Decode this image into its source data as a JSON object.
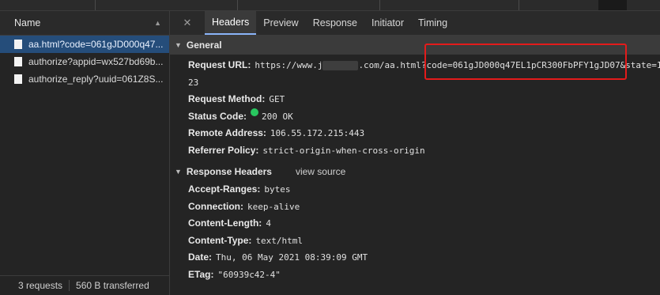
{
  "list": {
    "header": "Name",
    "requests": [
      "aa.html?code=061gJD000q47...",
      "authorize?appid=wx527bd69b...",
      "authorize_reply?uuid=061Z8S..."
    ],
    "footer": {
      "requests": "3 requests",
      "transferred": "560 B transferred"
    }
  },
  "tabs": [
    "Headers",
    "Preview",
    "Response",
    "Initiator",
    "Timing"
  ],
  "general": {
    "title": "General",
    "request_url_label": "Request URL:",
    "request_url_prefix": "https://www.j",
    "request_url_suffix": ".com/aa.html?code=061gJD000q47EL1pCR300FbPFY1gJD07&state=1",
    "request_url_wrap": "23",
    "method_label": "Request Method:",
    "method": "GET",
    "status_label": "Status Code:",
    "status": "200 OK",
    "remote_label": "Remote Address:",
    "remote": "106.55.172.215:443",
    "referrer_label": "Referrer Policy:",
    "referrer": "strict-origin-when-cross-origin"
  },
  "response": {
    "title": "Response Headers",
    "view_source": "view source",
    "headers": [
      {
        "k": "Accept-Ranges:",
        "v": "bytes"
      },
      {
        "k": "Connection:",
        "v": "keep-alive"
      },
      {
        "k": "Content-Length:",
        "v": "4"
      },
      {
        "k": "Content-Type:",
        "v": "text/html"
      },
      {
        "k": "Date:",
        "v": "Thu, 06 May 2021 08:39:09 GMT"
      },
      {
        "k": "ETag:",
        "v": "\"60939c42-4\""
      }
    ]
  }
}
